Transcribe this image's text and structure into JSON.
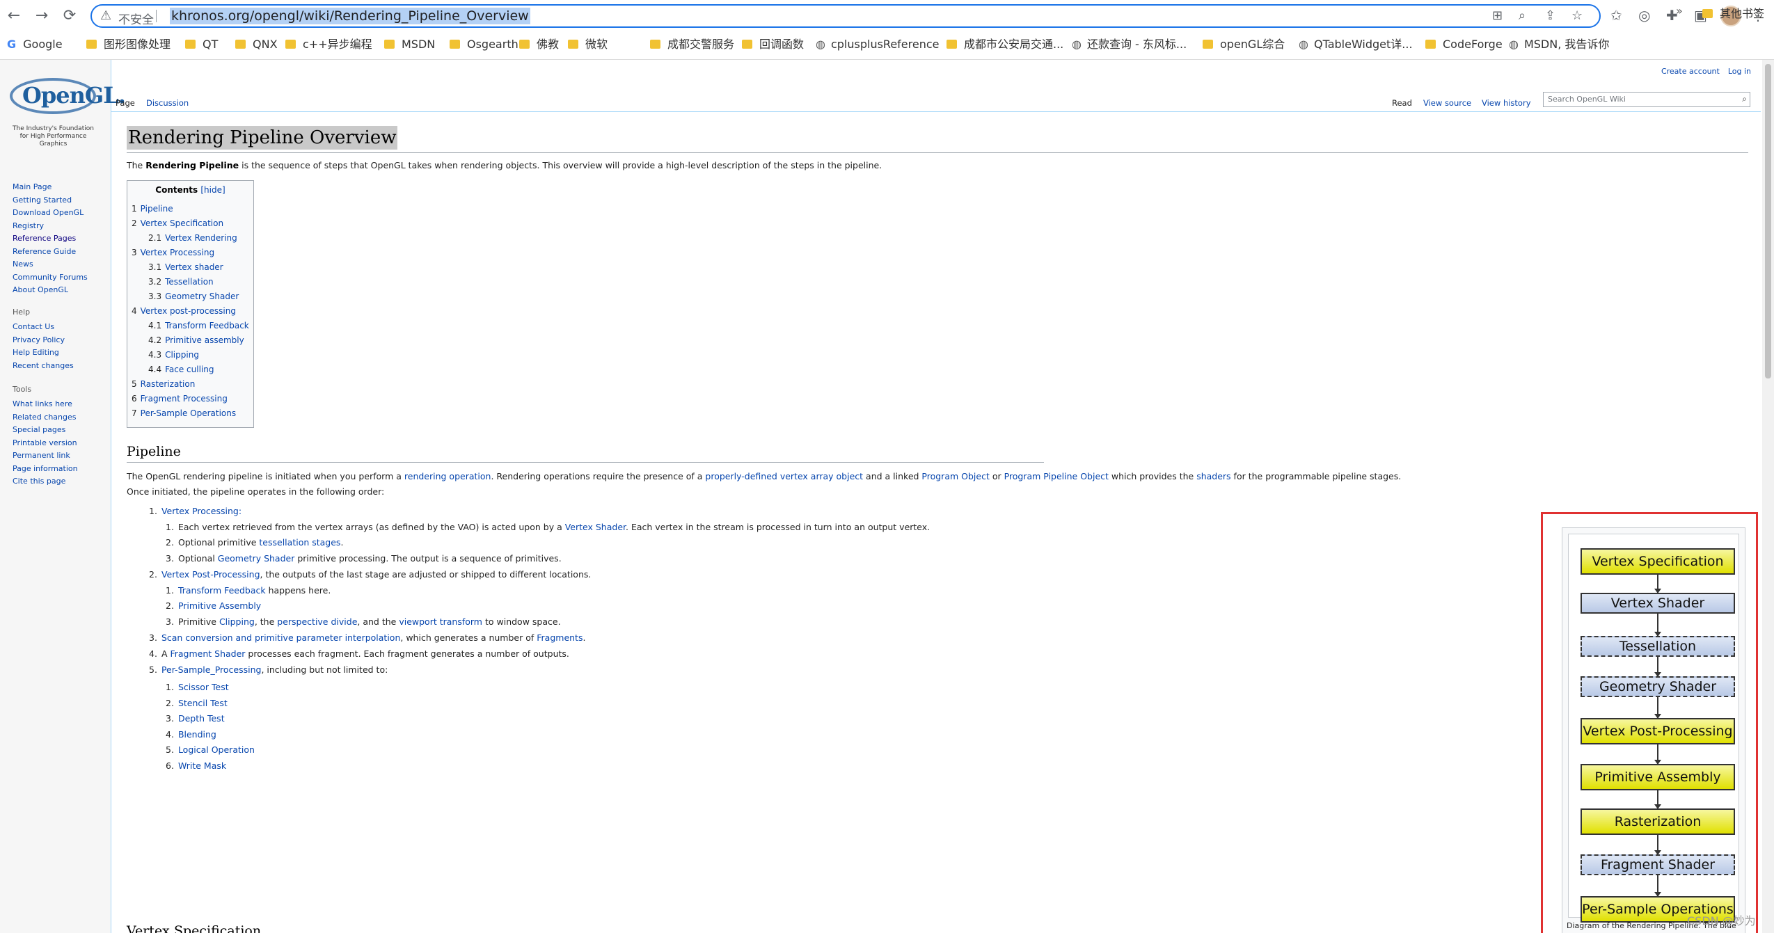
{
  "browser": {
    "security_text": "不安全",
    "url": "khronos.org/opengl/wiki/Rendering_Pipeline_Overview"
  },
  "bookmarks": {
    "items": [
      "Google",
      "图形图像处理",
      "QT",
      "QNX",
      "c++异步编程",
      "MSDN",
      "Osgearth",
      "佛教",
      "微软",
      "成都交警服务",
      "回调函数",
      "cplusplusReference",
      "成都市公安局交通...",
      "还款查询 - 东风标...",
      "openGL综合",
      "QTableWidget详...",
      "CodeForge",
      "MSDN, 我告诉你"
    ],
    "more": "»",
    "other": "其他书签"
  },
  "wiki": {
    "logo_word": "OpenGL.",
    "logo_tag": "The Industry's Foundation for High Performance Graphics",
    "top_links": [
      "Create account",
      "Log in"
    ],
    "tabs_left": [
      "Page",
      "Discussion"
    ],
    "tabs_right": [
      "Read",
      "View source",
      "View history"
    ],
    "search_placeholder": "Search OpenGL Wiki",
    "nav_links": [
      "Main Page",
      "Getting Started",
      "Download OpenGL",
      "Registry",
      "Reference Pages",
      "Reference Guide",
      "News",
      "Community Forums",
      "About OpenGL"
    ],
    "help_heading": "Help",
    "help_links": [
      "Contact Us",
      "Privacy Policy",
      "Help Editing",
      "Recent changes"
    ],
    "tools_heading": "Tools",
    "tools_links": [
      "What links here",
      "Related changes",
      "Special pages",
      "Printable version",
      "Permanent link",
      "Page information",
      "Cite this page"
    ]
  },
  "article": {
    "title": "Rendering Pipeline Overview",
    "intro_pre": "The ",
    "intro_bold": "Rendering Pipeline",
    "intro_post": " is the sequence of steps that OpenGL takes when rendering objects. This overview will provide a high-level description of the steps in the pipeline.",
    "toc_title": "Contents",
    "toc_hide": "[hide]",
    "toc": [
      {
        "n": "1",
        "t": "Pipeline",
        "sub": false
      },
      {
        "n": "2",
        "t": "Vertex Specification",
        "sub": false
      },
      {
        "n": "2.1",
        "t": "Vertex Rendering",
        "sub": true
      },
      {
        "n": "3",
        "t": "Vertex Processing",
        "sub": false
      },
      {
        "n": "3.1",
        "t": "Vertex shader",
        "sub": true
      },
      {
        "n": "3.2",
        "t": "Tessellation",
        "sub": true
      },
      {
        "n": "3.3",
        "t": "Geometry Shader",
        "sub": true
      },
      {
        "n": "4",
        "t": "Vertex post-processing",
        "sub": false
      },
      {
        "n": "4.1",
        "t": "Transform Feedback",
        "sub": true
      },
      {
        "n": "4.2",
        "t": "Primitive assembly",
        "sub": true
      },
      {
        "n": "4.3",
        "t": "Clipping",
        "sub": true
      },
      {
        "n": "4.4",
        "t": "Face culling",
        "sub": true
      },
      {
        "n": "5",
        "t": "Rasterization",
        "sub": false
      },
      {
        "n": "6",
        "t": "Fragment Processing",
        "sub": false
      },
      {
        "n": "7",
        "t": "Per-Sample Operations",
        "sub": false
      }
    ],
    "pipeline_heading": "Pipeline",
    "pipeline_p1": [
      {
        "t": "The OpenGL rendering pipeline is initiated when you perform a ",
        "l": false
      },
      {
        "t": "rendering operation",
        "l": true
      },
      {
        "t": ". Rendering operations require the presence of a ",
        "l": false
      },
      {
        "t": "properly-defined vertex array object",
        "l": true
      },
      {
        "t": " and a linked ",
        "l": false
      },
      {
        "t": "Program Object",
        "l": true
      },
      {
        "t": " or ",
        "l": false
      },
      {
        "t": "Program Pipeline Object",
        "l": true
      },
      {
        "t": " which provides the ",
        "l": false
      },
      {
        "t": "shaders",
        "l": true
      },
      {
        "t": " for the programmable pipeline stages.",
        "l": false
      }
    ],
    "pipeline_p2": "Once initiated, the pipeline operates in the following order:",
    "list": [
      {
        "lvl": 1,
        "num": "1.",
        "parts": [
          {
            "t": "Vertex Processing:",
            "l": true
          }
        ]
      },
      {
        "lvl": 2,
        "num": "1.",
        "parts": [
          {
            "t": "Each vertex retrieved from the vertex arrays (as defined by the VAO) is acted upon by a ",
            "l": false
          },
          {
            "t": "Vertex Shader",
            "l": true
          },
          {
            "t": ". Each vertex in the stream is processed in turn into an output vertex.",
            "l": false
          }
        ]
      },
      {
        "lvl": 2,
        "num": "2.",
        "parts": [
          {
            "t": "Optional primitive ",
            "l": false
          },
          {
            "t": "tessellation stages",
            "l": true
          },
          {
            "t": ".",
            "l": false
          }
        ]
      },
      {
        "lvl": 2,
        "num": "3.",
        "parts": [
          {
            "t": "Optional ",
            "l": false
          },
          {
            "t": "Geometry Shader",
            "l": true
          },
          {
            "t": " primitive processing. The output is a sequence of primitives.",
            "l": false
          }
        ]
      },
      {
        "lvl": 1,
        "num": "2.",
        "parts": [
          {
            "t": "Vertex Post-Processing",
            "l": true
          },
          {
            "t": ", the outputs of the last stage are adjusted or shipped to different locations.",
            "l": false
          }
        ]
      },
      {
        "lvl": 2,
        "num": "1.",
        "parts": [
          {
            "t": "Transform Feedback",
            "l": true
          },
          {
            "t": " happens here.",
            "l": false
          }
        ]
      },
      {
        "lvl": 2,
        "num": "2.",
        "parts": [
          {
            "t": "Primitive Assembly",
            "l": true
          }
        ]
      },
      {
        "lvl": 2,
        "num": "3.",
        "parts": [
          {
            "t": "Primitive ",
            "l": false
          },
          {
            "t": "Clipping",
            "l": true
          },
          {
            "t": ", the ",
            "l": false
          },
          {
            "t": "perspective divide",
            "l": true
          },
          {
            "t": ", and the ",
            "l": false
          },
          {
            "t": "viewport transform",
            "l": true
          },
          {
            "t": " to window space.",
            "l": false
          }
        ]
      },
      {
        "lvl": 1,
        "num": "3.",
        "parts": [
          {
            "t": "Scan conversion and primitive parameter interpolation",
            "l": true
          },
          {
            "t": ", which generates a number of ",
            "l": false
          },
          {
            "t": "Fragments",
            "l": true
          },
          {
            "t": ".",
            "l": false
          }
        ]
      },
      {
        "lvl": 1,
        "num": "4.",
        "parts": [
          {
            "t": "A ",
            "l": false
          },
          {
            "t": "Fragment Shader",
            "l": true
          },
          {
            "t": " processes each fragment. Each fragment generates a number of outputs.",
            "l": false
          }
        ]
      },
      {
        "lvl": 1,
        "num": "5.",
        "parts": [
          {
            "t": "Per-Sample_Processing",
            "l": true
          },
          {
            "t": ", including but not limited to:",
            "l": false
          }
        ]
      },
      {
        "lvl": 2,
        "num": "1.",
        "parts": [
          {
            "t": "Scissor Test",
            "l": true
          }
        ]
      },
      {
        "lvl": 2,
        "num": "2.",
        "parts": [
          {
            "t": "Stencil Test",
            "l": true
          }
        ]
      },
      {
        "lvl": 2,
        "num": "3.",
        "parts": [
          {
            "t": "Depth Test",
            "l": true
          }
        ]
      },
      {
        "lvl": 2,
        "num": "4.",
        "parts": [
          {
            "t": "Blending",
            "l": true
          }
        ]
      },
      {
        "lvl": 2,
        "num": "5.",
        "parts": [
          {
            "t": "Logical Operation",
            "l": true
          }
        ]
      },
      {
        "lvl": 2,
        "num": "6.",
        "parts": [
          {
            "t": "Write Mask",
            "l": true
          }
        ]
      }
    ],
    "next_heading": "Vertex Specification"
  },
  "diagram": {
    "stages": [
      {
        "label": "Vertex Specification",
        "kind": "fixed"
      },
      {
        "label": "Vertex Shader",
        "kind": "prog"
      },
      {
        "label": "Tessellation",
        "kind": "optional"
      },
      {
        "label": "Geometry Shader",
        "kind": "optional"
      },
      {
        "label": "Vertex Post-Processing",
        "kind": "fixed"
      },
      {
        "label": "Primitive Assembly",
        "kind": "fixed"
      },
      {
        "label": "Rasterization",
        "kind": "fixed"
      },
      {
        "label": "Fragment Shader",
        "kind": "optional"
      },
      {
        "label": "Per-Sample Operations",
        "kind": "fixed"
      }
    ],
    "caption": "Diagram of the Rendering Pipeline. The blue boxes are programmable shader stages.",
    "highlight_color": "#e03131"
  },
  "watermark": "CSDN @妙为"
}
